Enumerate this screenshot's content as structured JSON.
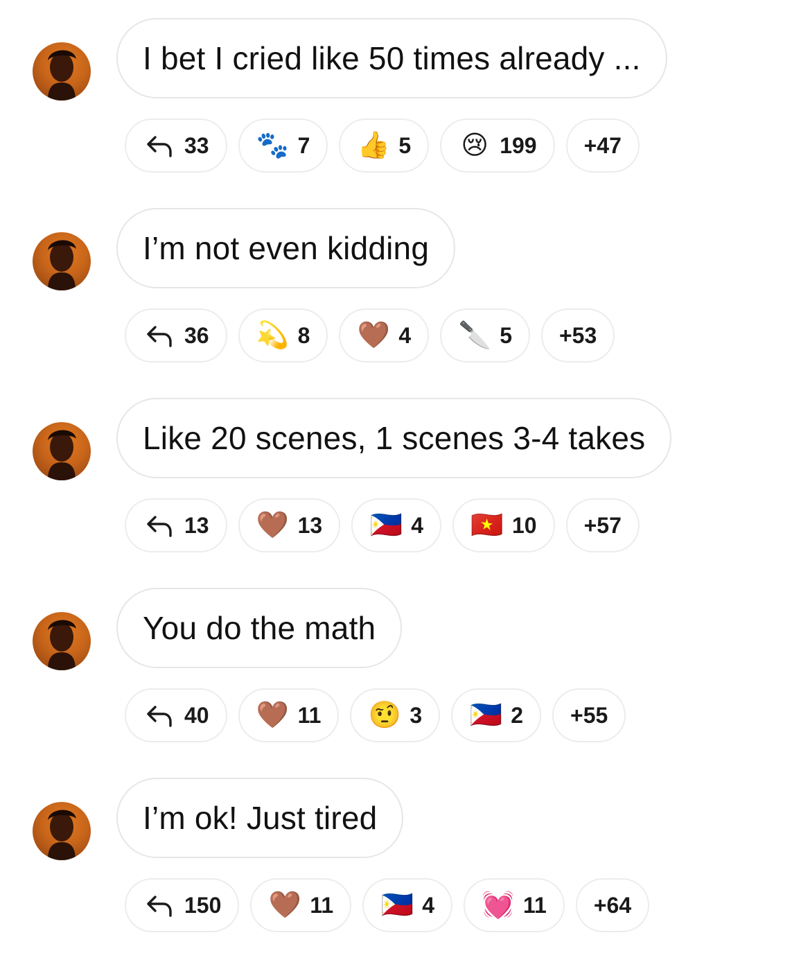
{
  "messages": [
    {
      "text": "I bet I cried like 50 times already ...",
      "reactions": [
        {
          "icon": "reply-arrow-icon",
          "count": "33"
        },
        {
          "icon": "paw-prints-icon",
          "emoji": "🐾",
          "count": "7"
        },
        {
          "icon": "thumbs-up-icon",
          "emoji": "👍",
          "count": "5"
        },
        {
          "icon": "crying-face-icon",
          "emoji": "😢",
          "count": "199"
        }
      ],
      "more": "+47"
    },
    {
      "text": "I’m not even kidding",
      "reactions": [
        {
          "icon": "reply-arrow-icon",
          "count": "36"
        },
        {
          "icon": "dizzy-icon",
          "emoji": "💫",
          "count": "8"
        },
        {
          "icon": "brown-heart-icon",
          "emoji": "🤎",
          "count": "4"
        },
        {
          "icon": "kitchen-knife-icon",
          "emoji": "🔪",
          "count": "5"
        }
      ],
      "more": "+53"
    },
    {
      "text": "Like 20 scenes, 1 scenes 3-4 takes",
      "reactions": [
        {
          "icon": "reply-arrow-icon",
          "count": "13"
        },
        {
          "icon": "brown-heart-icon",
          "emoji": "🤎",
          "count": "13"
        },
        {
          "icon": "philippines-flag-icon",
          "emoji": "🇵🇭",
          "count": "4"
        },
        {
          "icon": "vietnam-flag-icon",
          "emoji": "🇻🇳",
          "count": "10"
        }
      ],
      "more": "+57"
    },
    {
      "text": "You do the math",
      "reactions": [
        {
          "icon": "reply-arrow-icon",
          "count": "40"
        },
        {
          "icon": "brown-heart-icon",
          "emoji": "🤎",
          "count": "11"
        },
        {
          "icon": "raised-eyebrow-face-icon",
          "emoji": "🤨",
          "count": "3"
        },
        {
          "icon": "philippines-flag-icon",
          "emoji": "🇵🇭",
          "count": "2"
        }
      ],
      "more": "+55"
    },
    {
      "text": "I’m ok! Just tired",
      "reactions": [
        {
          "icon": "reply-arrow-icon",
          "count": "150"
        },
        {
          "icon": "brown-heart-icon",
          "emoji": "🤎",
          "count": "11"
        },
        {
          "icon": "philippines-flag-icon",
          "emoji": "🇵🇭",
          "count": "4"
        },
        {
          "icon": "growing-heart-icon",
          "emoji": "💓",
          "count": "11"
        }
      ],
      "more": "+64"
    }
  ],
  "colors": {
    "avatar_bg": "#c8651a",
    "bubble_border": "#e6e6e6",
    "text": "#111111"
  }
}
